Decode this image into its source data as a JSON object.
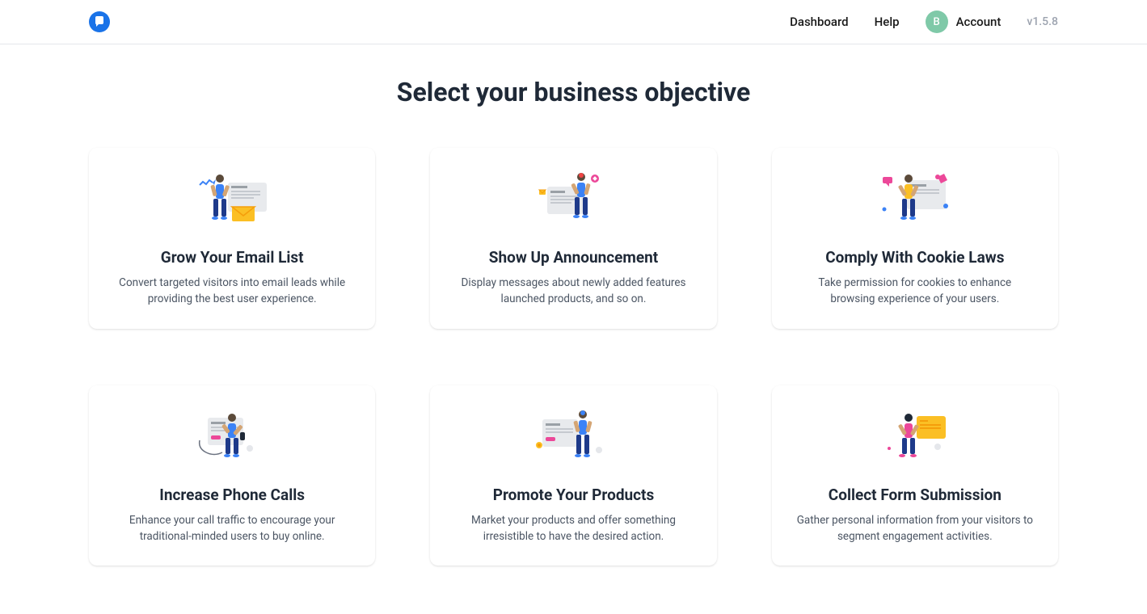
{
  "header": {
    "nav": {
      "dashboard": "Dashboard",
      "help": "Help",
      "account": "Account",
      "avatarLetter": "B"
    },
    "version": "v1.5.8"
  },
  "page": {
    "title": "Select your business objective"
  },
  "cards": [
    {
      "title": "Grow Your Email List",
      "desc": "Convert targeted visitors into email leads while providing the best user experience."
    },
    {
      "title": "Show Up Announcement",
      "desc": "Display messages about newly added features launched products, and so on."
    },
    {
      "title": "Comply With Cookie Laws",
      "desc": "Take permission for cookies to enhance browsing experience of your users."
    },
    {
      "title": "Increase Phone Calls",
      "desc": "Enhance your call traffic to encourage your traditional-minded users to buy online."
    },
    {
      "title": "Promote Your Products",
      "desc": "Market your products and offer something irresistible to have the desired action."
    },
    {
      "title": "Collect Form Submission",
      "desc": "Gather personal information from your visitors to segment engagement activities."
    }
  ]
}
